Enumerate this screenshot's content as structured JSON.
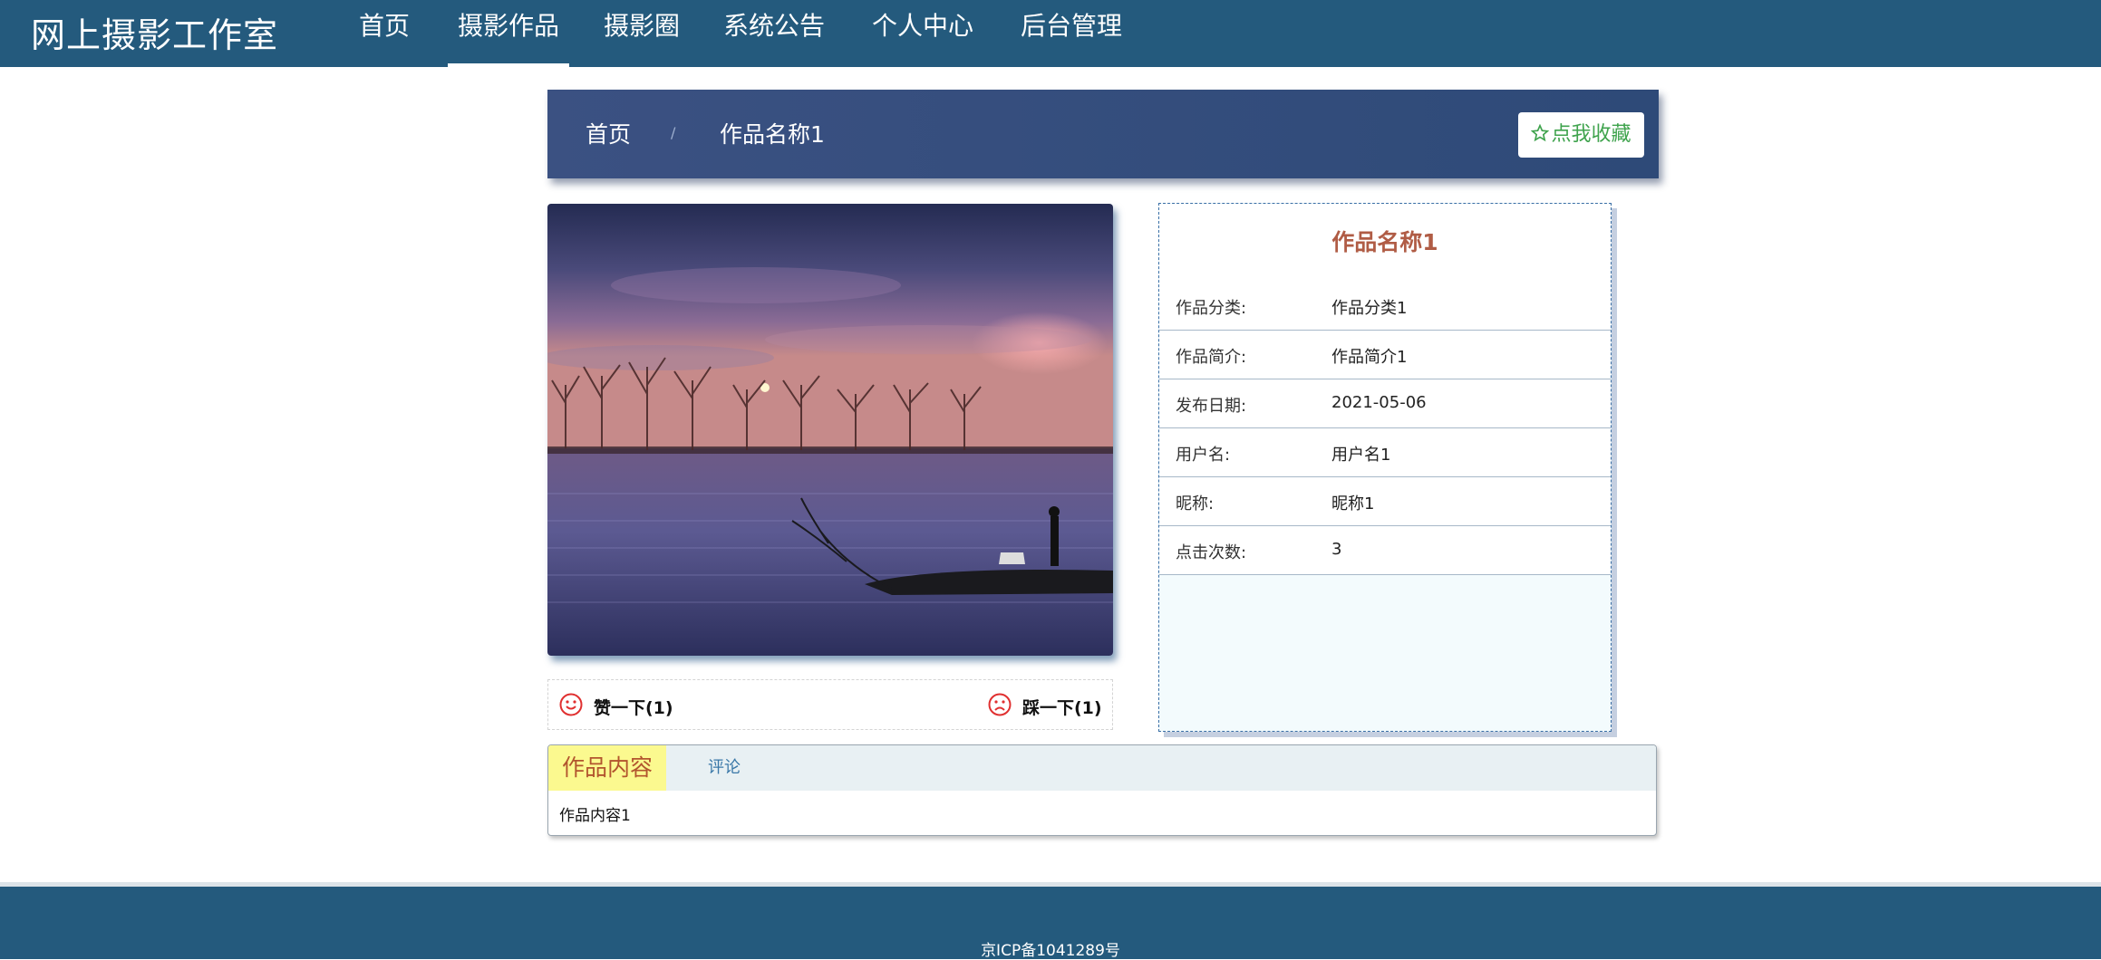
{
  "site": {
    "brand": "网上摄影工作室"
  },
  "nav": {
    "items": [
      {
        "label": "首页"
      },
      {
        "label": "摄影作品"
      },
      {
        "label": "摄影圈"
      },
      {
        "label": "系统公告"
      },
      {
        "label": "个人中心"
      },
      {
        "label": "后台管理"
      }
    ],
    "active_index": 1
  },
  "breadcrumb": {
    "home": "首页",
    "separator": "/",
    "current": "作品名称1"
  },
  "favorite_button": {
    "icon": "star-outline-icon",
    "label": "点我收藏",
    "color": "#3fa34d"
  },
  "reactions": {
    "like": {
      "icon": "smile-icon",
      "label": "赞一下(1)"
    },
    "dislike": {
      "icon": "frown-icon",
      "label": "踩一下(1)"
    }
  },
  "work": {
    "title": "作品名称1",
    "fields": [
      {
        "key": "作品分类:",
        "value": "作品分类1"
      },
      {
        "key": "作品简介:",
        "value": "作品简介1"
      },
      {
        "key": "发布日期:",
        "value": "2021-05-06"
      },
      {
        "key": "用户名:",
        "value": "用户名1"
      },
      {
        "key": "昵称:",
        "value": "昵称1"
      },
      {
        "key": "点击次数:",
        "value": "3"
      }
    ]
  },
  "tabs": {
    "items": [
      {
        "label": "作品内容"
      },
      {
        "label": "评论"
      }
    ],
    "content": "作品内容1"
  },
  "footer": {
    "icp": "京ICP备1041289号"
  },
  "colors": {
    "header": "#245a7d",
    "banner": "#3b5182",
    "title": "#b05c45",
    "tab_active_bg": "#fbf98f"
  }
}
